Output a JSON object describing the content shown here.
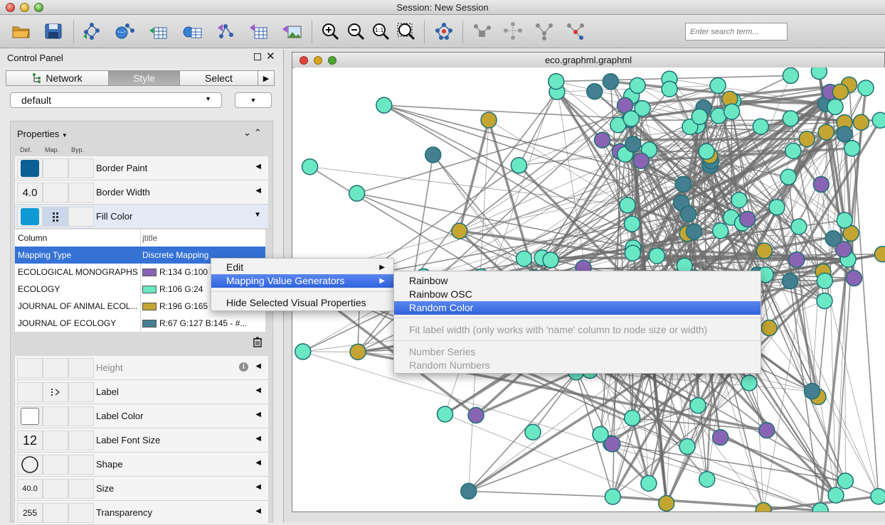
{
  "window": {
    "title": "Session: New Session"
  },
  "toolbar": {
    "search_placeholder": "Enter search term...",
    "buttons": [
      "open-session-icon",
      "save-session-icon",
      "import-network-file-icon",
      "import-network-url-icon",
      "import-table-file-icon",
      "import-table-url-icon",
      "export-network-icon",
      "export-table-icon",
      "export-image-icon",
      "zoom-in-icon",
      "zoom-out-icon",
      "zoom-fit-icon",
      "zoom-selected-icon",
      "apply-layout-icon",
      "first-neighbors-icon",
      "hide-selected-icon",
      "show-all-icon",
      "select-path-icon"
    ]
  },
  "control_panel": {
    "title": "Control Panel",
    "tabs": [
      {
        "label": "Network",
        "active": false
      },
      {
        "label": "Style",
        "active": true
      },
      {
        "label": "Select",
        "active": false
      }
    ],
    "style_select": "default",
    "properties_title": "Properties",
    "column_headers": {
      "def": "Def.",
      "map": "Map.",
      "byp": "Byp."
    },
    "rows": [
      {
        "name": "Border Paint",
        "default_color": "#0a5f96"
      },
      {
        "name": "Border Width",
        "default_value": "4.0"
      },
      {
        "name": "Fill Color",
        "default_color": "#0f9ad6"
      },
      {
        "name": "Height"
      },
      {
        "name": "Label"
      },
      {
        "name": "Label Color",
        "default_color": "#ffffff"
      },
      {
        "name": "Label Font Size",
        "default_value": "12"
      },
      {
        "name": "Shape"
      },
      {
        "name": "Size",
        "default_value": "40.0"
      },
      {
        "name": "Transparency",
        "default_value": "255"
      }
    ],
    "mapping": {
      "column_label": "Column",
      "column_value": "jtitle",
      "type_label": "Mapping Type",
      "type_value": "Discrete Mapping",
      "entries": [
        {
          "key": "ECOLOGICAL MONOGRAPHS",
          "color": "#8a64b4",
          "value": "R:134 G:100"
        },
        {
          "key": "ECOLOGY",
          "color": "#6ae8c3",
          "value": "R:106 G:24"
        },
        {
          "key": "JOURNAL OF ANIMAL ECOL...",
          "color": "#c4a531",
          "value": "R:196 G:165"
        },
        {
          "key": "JOURNAL OF ECOLOGY",
          "color": "#437f91",
          "value": "R:67 G:127 B:145 - #..."
        }
      ]
    }
  },
  "network_window": {
    "title": "eco.graphml.graphml"
  },
  "context_menu": {
    "items": [
      "Edit",
      "Mapping Value Generators",
      "Hide Selected Visual Properties"
    ]
  },
  "submenu": {
    "items": [
      "Rainbow",
      "Rainbow OSC",
      "Random Color",
      "Fit label width (only works with 'name' column to node size or width)",
      "Number Series",
      "Random Numbers"
    ]
  },
  "graph": {
    "node_colors": {
      "ecology": "#6ae8c3",
      "monographs": "#8a64b4",
      "animal_ecol": "#c4a531",
      "journal_ecology": "#437f91"
    },
    "edge_color": "#6e6e6e"
  }
}
